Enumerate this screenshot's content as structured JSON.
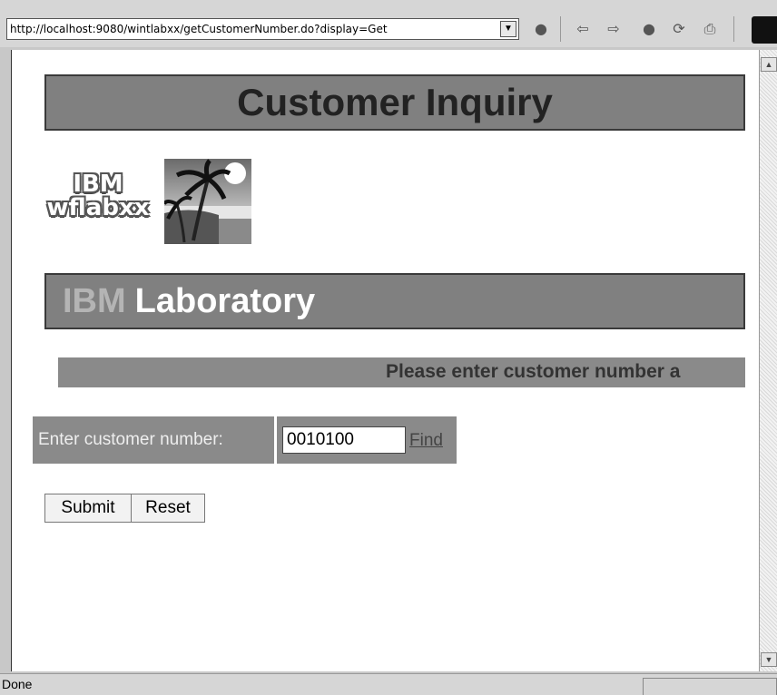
{
  "browser": {
    "url": "http://localhost:9080/wintlabxx/getCustomerNumber.do?display=Get",
    "icons": [
      "go-icon",
      "back-icon",
      "forward-icon",
      "stop-icon",
      "refresh-icon",
      "print-icon"
    ]
  },
  "page": {
    "title": "Customer Inquiry",
    "logo_text_line1": "IBM",
    "logo_text_line2": "wflabxx",
    "lab_ibm": "IBM",
    "lab_word": "Laboratory",
    "instruction": "Please enter customer number a",
    "form": {
      "label": "Enter customer number:",
      "customer_number": "0010100",
      "find_link": "Find",
      "submit_label": "Submit",
      "reset_label": "Reset"
    }
  },
  "status": {
    "text": "Done"
  },
  "colors": {
    "banner": "#808080",
    "page_bg": "#ffffff",
    "chrome": "#d6d6d6"
  }
}
